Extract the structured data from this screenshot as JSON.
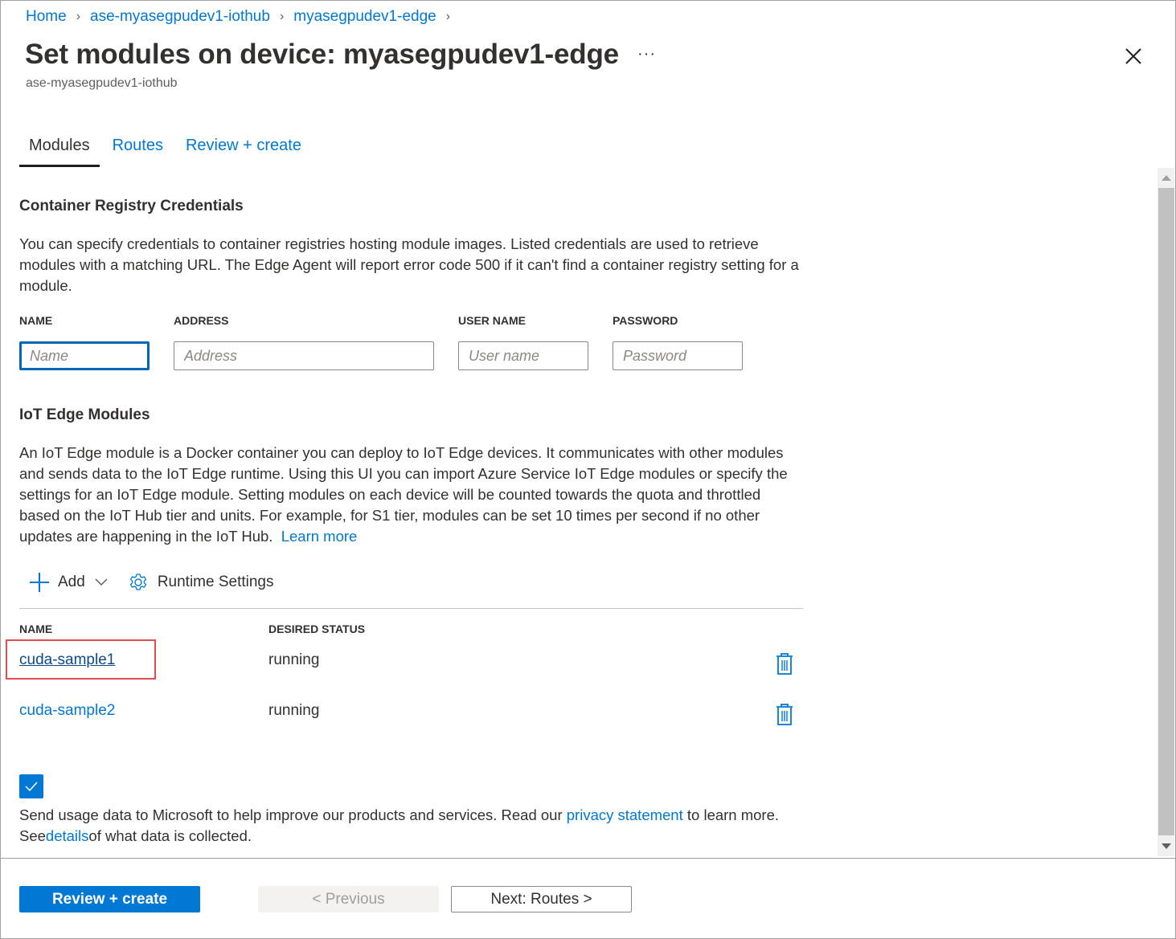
{
  "breadcrumb": [
    {
      "label": "Home"
    },
    {
      "label": "ase-myasegpudev1-iothub"
    },
    {
      "label": "myasegpudev1-edge"
    }
  ],
  "header": {
    "title": "Set modules on device: myasegpudev1-edge",
    "subtitle": "ase-myasegpudev1-iothub",
    "more_label": "···"
  },
  "tabs": [
    {
      "label": "Modules",
      "active": true
    },
    {
      "label": "Routes",
      "active": false
    },
    {
      "label": "Review + create",
      "active": false
    }
  ],
  "registry": {
    "heading": "Container Registry Credentials",
    "description": "You can specify credentials to container registries hosting module images. Listed credentials are used to retrieve modules with a matching URL. The Edge Agent will report error code 500 if it can't find a container registry setting for a module.",
    "fields": [
      {
        "label": "NAME",
        "placeholder": "Name",
        "value": ""
      },
      {
        "label": "ADDRESS",
        "placeholder": "Address",
        "value": ""
      },
      {
        "label": "USER NAME",
        "placeholder": "User name",
        "value": ""
      },
      {
        "label": "PASSWORD",
        "placeholder": "Password",
        "value": ""
      }
    ]
  },
  "modules": {
    "heading": "IoT Edge Modules",
    "description": "An IoT Edge module is a Docker container you can deploy to IoT Edge devices. It communicates with other modules and sends data to the IoT Edge runtime. Using this UI you can import Azure Service IoT Edge modules or specify the settings for an IoT Edge module. Setting modules on each device will be counted towards the quota and throttled based on the IoT Hub tier and units. For example, for S1 tier, modules can be set 10 times per second if no other updates are happening in the IoT Hub.",
    "learn_more": "Learn more",
    "toolbar": {
      "add_label": "Add",
      "runtime_label": "Runtime Settings"
    },
    "columns": {
      "name": "NAME",
      "status": "DESIRED STATUS"
    },
    "rows": [
      {
        "name": "cuda-sample1",
        "status": "running"
      },
      {
        "name": "cuda-sample2",
        "status": "running"
      }
    ]
  },
  "consent": {
    "checked": true,
    "text_before": "Send usage data to Microsoft to help improve our products and services. Read our ",
    "privacy_link": "privacy statement",
    "text_middle": " to learn more. See",
    "details_link": "details",
    "text_after": "of what data is collected."
  },
  "footer": {
    "review_create": "Review + create",
    "previous": "< Previous",
    "next": "Next: Routes >"
  },
  "colors": {
    "accent": "#0078d4",
    "highlight": "#e74c4c"
  }
}
